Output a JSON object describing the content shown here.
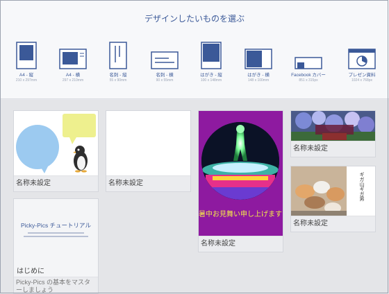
{
  "header": {
    "title": "デザインしたいものを選ぶ"
  },
  "sizes": [
    {
      "label": "A4 - 縦",
      "dim": "210 x 297mm",
      "icon": "portrait-doc-icon"
    },
    {
      "label": "A4 - 横",
      "dim": "297 x 210mm",
      "icon": "landscape-doc-icon"
    },
    {
      "label": "名刺 - 縦",
      "dim": "55 x 90mm",
      "icon": "vertical-card-icon"
    },
    {
      "label": "名刺 - 横",
      "dim": "90 x 55mm",
      "icon": "horizontal-card-icon"
    },
    {
      "label": "はがき - 縦",
      "dim": "100 x 148mm",
      "icon": "postcard-vertical-icon"
    },
    {
      "label": "はがき - 横",
      "dim": "148 x 100mm",
      "icon": "postcard-horizontal-icon"
    },
    {
      "label": "Facebook カバー",
      "dim": "851 x 315px",
      "icon": "facebook-cover-icon"
    },
    {
      "label": "プレゼン資料",
      "dim": "1024 x 768px",
      "icon": "presentation-icon"
    }
  ],
  "cards": [
    {
      "caption": "名称未設定",
      "thumb": "speech-bubbles-penguin"
    },
    {
      "caption": "名称未設定",
      "thumb": "blank"
    },
    {
      "caption": "名称未設定",
      "thumb": "glowing-figure-ufo",
      "text": "暑中お見舞い申し上げます"
    },
    {
      "caption": "名称未設定",
      "thumb": "hydrangea-photo"
    },
    {
      "caption": "名称未設定",
      "thumb": "cats-photo",
      "text": "ギガ山ギガ男"
    },
    {
      "caption": "はじめに",
      "thumb": "tutorial",
      "title": "Picky-Pics チュートリアル",
      "subtitle": "Picky-Pics の基本をマスターしましょう"
    }
  ],
  "colors": {
    "accent": "#3b5998",
    "purple": "#8e1aa0",
    "bubble_blue": "#9ccaf0",
    "bubble_yellow": "#eef08e"
  }
}
